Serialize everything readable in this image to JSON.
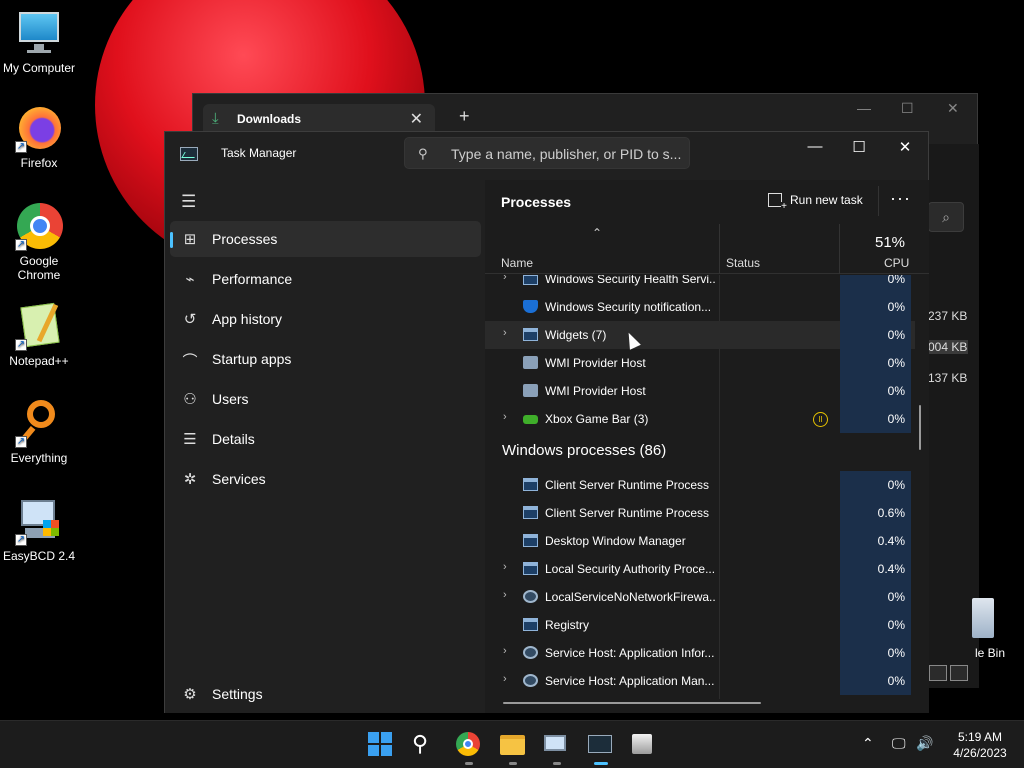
{
  "desktop": {
    "icons": [
      {
        "label": "My Computer",
        "icon": "monitor-icon"
      },
      {
        "label": "Firefox",
        "icon": "firefox-icon"
      },
      {
        "label": "Google Chrome",
        "icon": "chrome-icon"
      },
      {
        "label": "Notepad++",
        "icon": "notepadpp-icon"
      },
      {
        "label": "Everything",
        "icon": "everything-search-icon"
      },
      {
        "label": "EasyBCD 2.4",
        "icon": "easybcd-icon"
      }
    ],
    "recycle_bin_label": "le Bin"
  },
  "explorer": {
    "tab_title": "Downloads",
    "new_tab": "+",
    "close_tab": "✕",
    "sizes": [
      "237 KB",
      "004 KB",
      "137 KB"
    ]
  },
  "taskmanager": {
    "title": "Task Manager",
    "search_placeholder": "Type a name, publisher, or PID to s...",
    "window_controls": {
      "minimize": "—",
      "maximize": "☐",
      "close": "✕"
    },
    "nav": [
      {
        "label": "Processes",
        "icon": "processes-icon",
        "glyph": "⊞",
        "active": true
      },
      {
        "label": "Performance",
        "icon": "performance-icon",
        "glyph": "⌁",
        "active": false
      },
      {
        "label": "App history",
        "icon": "app-history-icon",
        "glyph": "↺",
        "active": false
      },
      {
        "label": "Startup apps",
        "icon": "startup-apps-icon",
        "glyph": "⌒",
        "active": false
      },
      {
        "label": "Users",
        "icon": "users-icon",
        "glyph": "⚇",
        "active": false
      },
      {
        "label": "Details",
        "icon": "details-icon",
        "glyph": "☰",
        "active": false
      },
      {
        "label": "Services",
        "icon": "services-icon",
        "glyph": "✲",
        "active": false
      }
    ],
    "settings_label": "Settings",
    "page_title": "Processes",
    "run_new_task": "Run new task",
    "more": "···",
    "columns": {
      "name": "Name",
      "status": "Status",
      "cpu_total": "51%",
      "cpu": "CPU"
    },
    "apps_rows": [
      {
        "name": "Windows Security Health Servi...",
        "cpu": "0%",
        "expandable": true,
        "icon": "win"
      },
      {
        "name": "Windows Security notification...",
        "cpu": "0%",
        "expandable": false,
        "icon": "shield"
      },
      {
        "name": "Widgets (7)",
        "cpu": "0%",
        "expandable": true,
        "icon": "win"
      },
      {
        "name": "WMI Provider Host",
        "cpu": "0%",
        "expandable": false,
        "icon": "wmi"
      },
      {
        "name": "WMI Provider Host",
        "cpu": "0%",
        "expandable": false,
        "icon": "wmi"
      },
      {
        "name": "Xbox Game Bar (3)",
        "cpu": "0%",
        "expandable": true,
        "icon": "xbox",
        "paused": true
      }
    ],
    "group_title": "Windows processes (86)",
    "windows_rows": [
      {
        "name": "Client Server Runtime Process",
        "cpu": "0%",
        "expandable": false,
        "icon": "win"
      },
      {
        "name": "Client Server Runtime Process",
        "cpu": "0.6%",
        "expandable": false,
        "icon": "win"
      },
      {
        "name": "Desktop Window Manager",
        "cpu": "0.4%",
        "expandable": false,
        "icon": "win"
      },
      {
        "name": "Local Security Authority Proce...",
        "cpu": "0.4%",
        "expandable": true,
        "icon": "win"
      },
      {
        "name": "LocalServiceNoNetworkFirewa...",
        "cpu": "0%",
        "expandable": true,
        "icon": "gear"
      },
      {
        "name": "Registry",
        "cpu": "0%",
        "expandable": false,
        "icon": "win"
      },
      {
        "name": "Service Host: Application Infor...",
        "cpu": "0%",
        "expandable": true,
        "icon": "gear"
      },
      {
        "name": "Service Host: Application Man...",
        "cpu": "0%",
        "expandable": true,
        "icon": "gear"
      }
    ],
    "cpu_cell_color": "#1b2f4a"
  },
  "taskbar": {
    "items": [
      "start-icon",
      "search-icon",
      "chrome-icon",
      "file-explorer-icon",
      "remote-desktop-icon",
      "task-manager-icon",
      "app-icon"
    ],
    "time": "5:19 AM",
    "date": "4/26/2023"
  }
}
